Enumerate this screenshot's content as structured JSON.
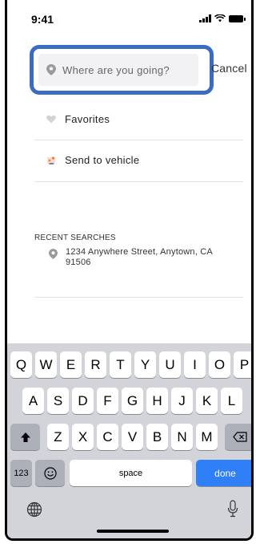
{
  "status_bar": {
    "time": "9:41"
  },
  "search": {
    "placeholder": "Where are you going?",
    "cancel_label": "Cancel"
  },
  "menu": [
    {
      "label": "Favorites",
      "icon": "heart-icon"
    },
    {
      "label": "Send to vehicle",
      "icon": "send-to-vehicle-icon"
    }
  ],
  "recent": {
    "title": "RECENT SEARCHES",
    "items": [
      {
        "address": "1234 Anywhere Street, Anytown, CA 91506",
        "icon": "location-pin-icon"
      }
    ]
  },
  "keyboard": {
    "row1": [
      "Q",
      "W",
      "E",
      "R",
      "T",
      "Y",
      "U",
      "I",
      "O",
      "P"
    ],
    "row2": [
      "A",
      "S",
      "D",
      "F",
      "G",
      "H",
      "J",
      "K",
      "L"
    ],
    "row3": [
      "Z",
      "X",
      "C",
      "V",
      "B",
      "N",
      "M"
    ],
    "numbers_label": "123",
    "space_label": "space",
    "done_label": "done"
  },
  "colors": {
    "accent_border": "#3a6cc2",
    "done_key": "#2f80f7",
    "keyboard_bg": "#d2d4da"
  }
}
